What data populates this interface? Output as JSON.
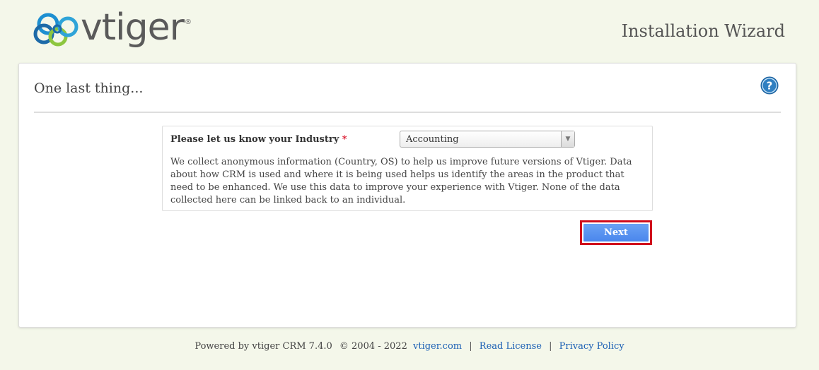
{
  "header": {
    "logo_text": "vtiger",
    "logo_reg": "®",
    "wizard_title": "Installation Wizard"
  },
  "panel": {
    "heading": "One last thing...",
    "help_icon": "question-circle-icon",
    "industry_label": "Please let us know your Industry",
    "required_mark": "*",
    "industry_selected": "Accounting",
    "select_arrow": "▼",
    "info_text": "We collect anonymous information (Country, OS) to help us improve future versions of Vtiger. Data about how CRM is used and where it is being used helps us identify the areas in the product that need to be enhanced. We use this data to improve your experience with Vtiger. None of the data collected here can be linked back to an individual.",
    "next_label": "Next"
  },
  "footer": {
    "powered_by": "Powered by vtiger CRM 7.4.0",
    "copyright": "© 2004 - 2022",
    "site_link": "vtiger.com",
    "separator": "|",
    "license_link": "Read License",
    "privacy_link": "Privacy Policy"
  },
  "colors": {
    "background": "#f4f7ea",
    "accent_blue": "#4a86ec",
    "highlight_red": "#d00c1c",
    "link": "#1a5fb4"
  }
}
